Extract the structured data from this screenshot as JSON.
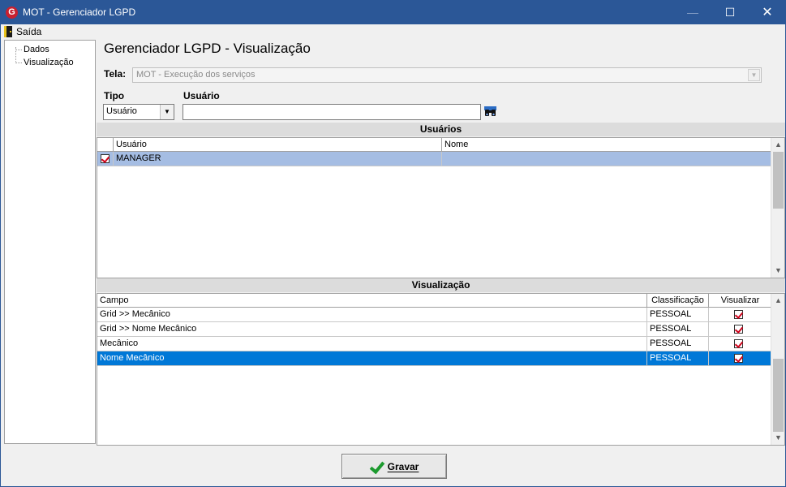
{
  "window": {
    "title": "MOT - Gerenciador LGPD",
    "app_icon": "G",
    "minimize": "—",
    "maximize": "☐",
    "close": "✕"
  },
  "menu": {
    "saida_label": "Saída"
  },
  "tree": {
    "items": [
      "Dados",
      "Visualização"
    ]
  },
  "page": {
    "title": "Gerenciador LGPD - Visualização"
  },
  "form": {
    "tela_label": "Tela:",
    "tela_value": "MOT - Execução dos serviços",
    "tipo_label": "Tipo",
    "tipo_value": "Usuário",
    "usuario_label": "Usuário",
    "usuario_value": ""
  },
  "usuarios": {
    "header": "Usuários",
    "columns": [
      "Usuário",
      "Nome"
    ],
    "rows": [
      {
        "checked": true,
        "usuario": "MANAGER",
        "nome": ""
      }
    ]
  },
  "visualizacao": {
    "header": "Visualização",
    "columns": [
      "Campo",
      "Classificação",
      "Visualizar"
    ],
    "rows": [
      {
        "campo": "Grid >> Mecânico",
        "classificacao": "PESSOAL",
        "visualizar": true
      },
      {
        "campo": "Grid >> Nome Mecânico",
        "classificacao": "PESSOAL",
        "visualizar": true
      },
      {
        "campo": "Mecânico",
        "classificacao": "PESSOAL",
        "visualizar": true
      },
      {
        "campo": "Nome Mecânico",
        "classificacao": "PESSOAL",
        "visualizar": true
      }
    ]
  },
  "actions": {
    "gravar_label": "Gravar"
  },
  "colors": {
    "titlebar": "#2b5797",
    "selected_light": "#a5bde3",
    "selected_dark": "#0078d7",
    "check_red": "#d0021b",
    "gravar_green": "#1c9a2e"
  }
}
